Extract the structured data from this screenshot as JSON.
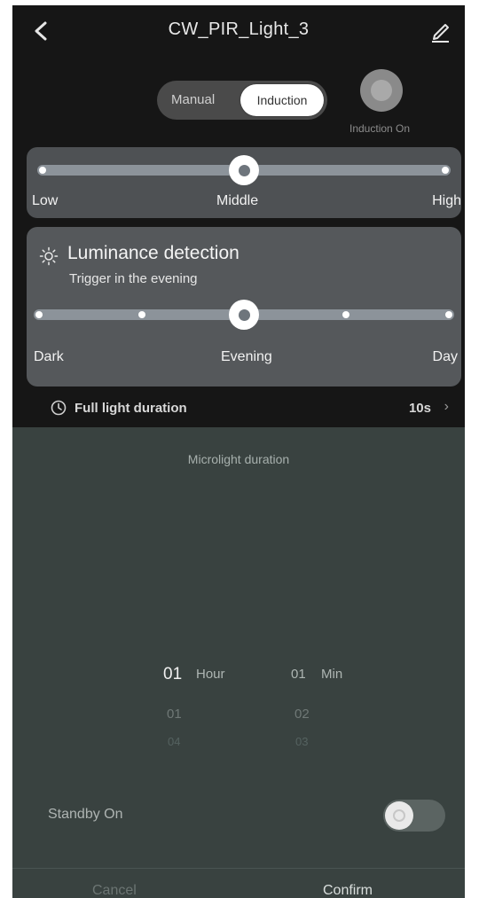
{
  "header": {
    "title": "CW_PIR_Light_3"
  },
  "icons": {
    "back": "chevron-left-icon",
    "edit": "pencil-icon",
    "luminance": "sun-icon",
    "duration": "clock-icon",
    "chevron": "chevron-right-icon"
  },
  "mode": {
    "manual_label": "Manual",
    "induction_label": "Induction",
    "selected": "Induction"
  },
  "induction_button": {
    "label": "Induction On"
  },
  "sensitivity": {
    "labels": [
      "Low",
      "Middle",
      "High"
    ],
    "selected": "Middle"
  },
  "luminance": {
    "title": "Luminance detection",
    "subtitle": "Trigger in the evening",
    "labels": [
      "Dark",
      "Evening",
      "Day"
    ],
    "selected": "Evening"
  },
  "full_light": {
    "label": "Full light duration",
    "value": "10s",
    "chevron": "›"
  },
  "sheet": {
    "title": "Microlight duration",
    "picker": {
      "hour_value": "01",
      "hour_unit": "Hour",
      "min_value": "01",
      "min_unit": "Min",
      "hour_next1": "01",
      "hour_next2": "04",
      "min_next1": "02",
      "min_next2": "03"
    },
    "standby_label": "Standby On",
    "standby_on": false,
    "cancel_label": "Cancel",
    "confirm_label": "Confirm"
  },
  "colors": {
    "background": "#161616",
    "card": "#4e5154",
    "sheet": "#394240",
    "track": "#8c939a",
    "thumb": "#ffffff"
  }
}
